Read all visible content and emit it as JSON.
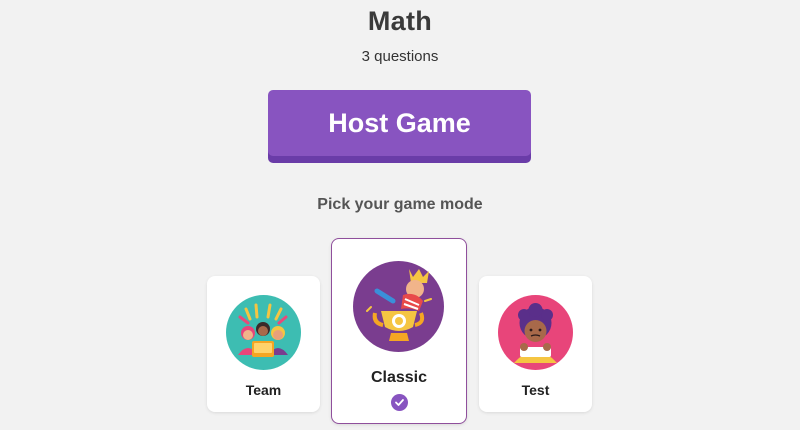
{
  "quiz": {
    "title": "Math",
    "subtitle": "3 questions"
  },
  "host_button": {
    "label": "Host Game"
  },
  "mode_picker": {
    "heading": "Pick your game mode",
    "modes": [
      {
        "label": "Team",
        "icon": "team-illustration-icon",
        "selected": false
      },
      {
        "label": "Classic",
        "icon": "trophy-illustration-icon",
        "selected": true
      },
      {
        "label": "Test",
        "icon": "student-illustration-icon",
        "selected": false
      }
    ]
  },
  "colors": {
    "background": "#f2f2f2",
    "accent": "#8854c0",
    "accent_shadow": "#6a3ca8",
    "selected_border": "#8f4f9c",
    "team_circle": "#3dbdb2",
    "classic_circle": "#7a3d8f",
    "test_circle": "#e8457a"
  }
}
